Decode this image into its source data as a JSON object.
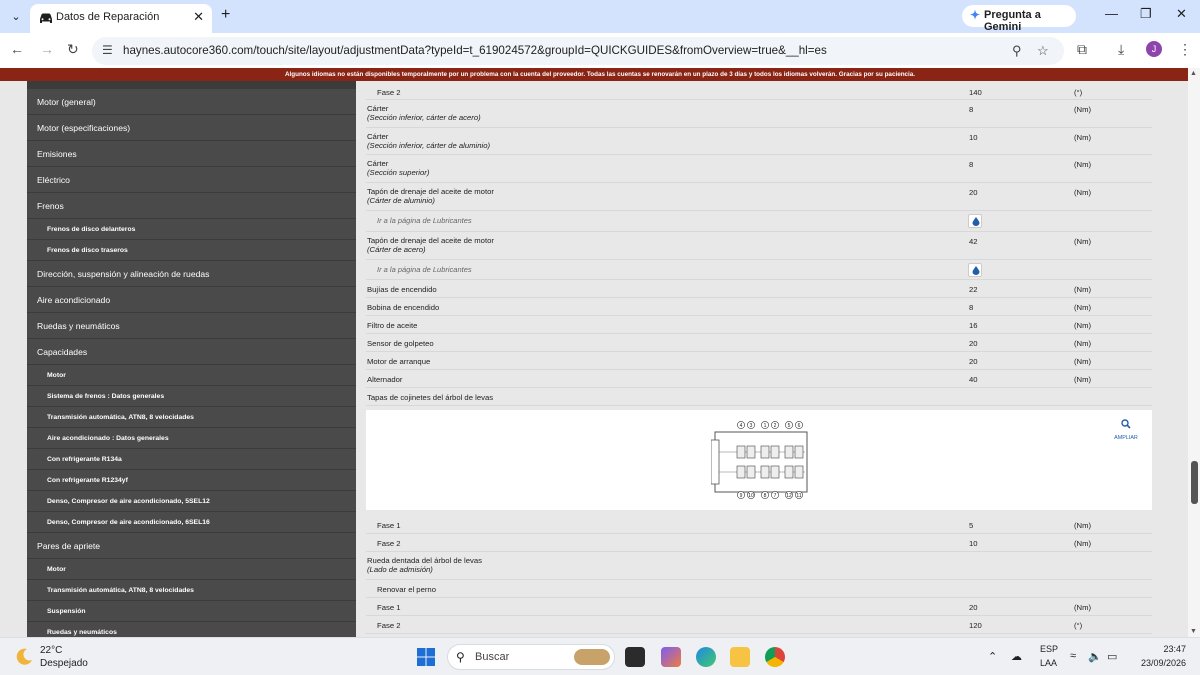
{
  "browser": {
    "tab_title": "Datos de Reparación",
    "gemini_label": "Pregunta a Gemini",
    "url": "haynes.autocore360.com/touch/site/layout/adjustmentData?typeId=t_619024572&groupId=QUICKGUIDES&fromOverview=true&__hl=es",
    "avatar_letter": "J"
  },
  "banner": "Algunos idiomas no están disponibles temporalmente por un problema con la cuenta del proveedor. Todas las cuentas se renovarán en un plazo de 3 días y todos los idiomas volverán. Gracias por su paciencia.",
  "sidebar": {
    "items": [
      {
        "label": "Motor (general)",
        "type": "item"
      },
      {
        "label": "Motor (especificaciones)",
        "type": "item"
      },
      {
        "label": "Emisiones",
        "type": "item"
      },
      {
        "label": "Eléctrico",
        "type": "item"
      },
      {
        "label": "Frenos",
        "type": "item"
      },
      {
        "label": "Frenos de disco delanteros",
        "type": "sub"
      },
      {
        "label": "Frenos de disco traseros",
        "type": "sub"
      },
      {
        "label": "Dirección, suspensión y alineación de ruedas",
        "type": "item"
      },
      {
        "label": "Aire acondicionado",
        "type": "item"
      },
      {
        "label": "Ruedas y neumáticos",
        "type": "item"
      },
      {
        "label": "Capacidades",
        "type": "item"
      },
      {
        "label": "Motor",
        "type": "sub"
      },
      {
        "label": "Sistema de frenos : Datos generales",
        "type": "sub"
      },
      {
        "label": "Transmisión automática, ATN8, 8 velocidades",
        "type": "sub"
      },
      {
        "label": "Aire acondicionado : Datos generales",
        "type": "sub"
      },
      {
        "label": "Con refrigerante R134a",
        "type": "sub"
      },
      {
        "label": "Con refrigerante R1234yf",
        "type": "sub"
      },
      {
        "label": "Denso, Compresor de aire acondicionado, 5SEL12",
        "type": "sub"
      },
      {
        "label": "Denso, Compresor de aire acondicionado, 6SEL16",
        "type": "sub"
      },
      {
        "label": "Pares de apriete",
        "type": "item"
      },
      {
        "label": "Motor",
        "type": "sub"
      },
      {
        "label": "Transmisión automática, ATN8, 8 velocidades",
        "type": "sub"
      },
      {
        "label": "Suspensión",
        "type": "sub"
      },
      {
        "label": "Ruedas y neumáticos",
        "type": "sub"
      }
    ]
  },
  "content": {
    "rows": [
      {
        "name": "Fase 2",
        "sub": "",
        "value": "140",
        "unit": "(°)",
        "indent": true
      },
      {
        "name": "Cárter",
        "sub": "(Sección inferior, cárter de acero)",
        "value": "8",
        "unit": "(Nm)",
        "indent": false
      },
      {
        "name": "Cárter",
        "sub": "(Sección inferior, cárter de aluminio)",
        "value": "10",
        "unit": "(Nm)",
        "indent": false
      },
      {
        "name": "Cárter",
        "sub": "(Sección superior)",
        "value": "8",
        "unit": "(Nm)",
        "indent": false
      },
      {
        "name": "Tapón de drenaje del aceite de motor",
        "sub": "(Cárter de aluminio)",
        "value": "20",
        "unit": "(Nm)",
        "indent": false
      },
      {
        "name": "Ir a la página de Lubricantes",
        "kind": "link"
      },
      {
        "name": "Tapón de drenaje del aceite de motor",
        "sub": "(Cárter de acero)",
        "value": "42",
        "unit": "(Nm)",
        "indent": false
      },
      {
        "name": "Ir a la página de Lubricantes",
        "kind": "link"
      },
      {
        "name": "Bujías de encendido",
        "sub": "",
        "value": "22",
        "unit": "(Nm)",
        "indent": false
      },
      {
        "name": "Bobina de encendido",
        "sub": "",
        "value": "8",
        "unit": "(Nm)",
        "indent": false
      },
      {
        "name": "Filtro de aceite",
        "sub": "",
        "value": "16",
        "unit": "(Nm)",
        "indent": false
      },
      {
        "name": "Sensor de golpeteo",
        "sub": "",
        "value": "20",
        "unit": "(Nm)",
        "indent": false
      },
      {
        "name": "Motor de arranque",
        "sub": "",
        "value": "20",
        "unit": "(Nm)",
        "indent": false
      },
      {
        "name": "Alternador",
        "sub": "",
        "value": "40",
        "unit": "(Nm)",
        "indent": false
      },
      {
        "name": "Tapas de cojinetes del árbol de levas",
        "sub": "",
        "value": "",
        "unit": "",
        "indent": false
      },
      {
        "name": "Fase 1",
        "sub": "",
        "value": "5",
        "unit": "(Nm)",
        "indent": true
      },
      {
        "name": "Fase 2",
        "sub": "",
        "value": "10",
        "unit": "(Nm)",
        "indent": true
      },
      {
        "name": "Rueda dentada del árbol de levas",
        "sub": "(Lado de admisión)",
        "value": "",
        "unit": "",
        "indent": false
      },
      {
        "name": "Renovar el perno",
        "sub": "",
        "value": "",
        "unit": "",
        "indent": true
      },
      {
        "name": "Fase 1",
        "sub": "",
        "value": "20",
        "unit": "(Nm)",
        "indent": true
      },
      {
        "name": "Fase 2",
        "sub": "",
        "value": "120",
        "unit": "(°)",
        "indent": true
      }
    ],
    "zoom_label": "AMPLIAR",
    "figure_labels": {
      "top": [
        "4",
        "3",
        "1",
        "2",
        "5",
        "6"
      ],
      "bottom": [
        "9",
        "10",
        "8",
        "7",
        "12",
        "11"
      ]
    }
  },
  "taskbar": {
    "temperature": "22°C",
    "weather": "Despejado",
    "search_placeholder": "Buscar",
    "lang_code": "ESP",
    "lang_layout": "LAA",
    "time": "23:47",
    "date": "23/09/2026"
  },
  "colors": {
    "banner_bg": "#8a2415",
    "sidebar_bg": "#4a4a4a",
    "content_bg": "#e8e8e8",
    "accent": "#235ea9",
    "tabstrip_bg": "#d3e3fd"
  },
  "icons": [
    "chevron-down-icon",
    "car-icon",
    "close-icon",
    "plus-icon",
    "gemini-icon",
    "back-icon",
    "forward-icon",
    "reload-icon",
    "tune-icon",
    "zoom-out-icon",
    "star-icon",
    "extensions-icon",
    "download-icon",
    "menu-dots-icon",
    "oil-drop-icon",
    "magnifier-icon",
    "moon-icon",
    "windows-start-icon",
    "search-icon"
  ]
}
